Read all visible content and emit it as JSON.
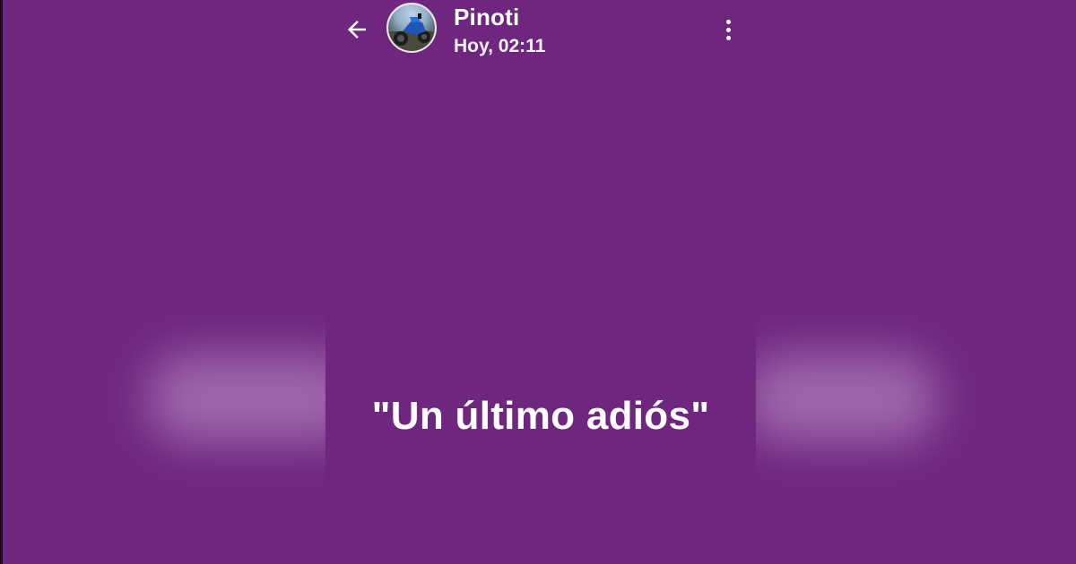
{
  "story": {
    "contact_name": "Pinoti",
    "timestamp": "Hoy, 02:11",
    "caption": "\"Un último adiós\"",
    "background_color": "#6e267e"
  },
  "icons": {
    "back": "arrow-left-icon",
    "menu": "more-vertical-icon",
    "avatar": "motorcycle-photo"
  }
}
